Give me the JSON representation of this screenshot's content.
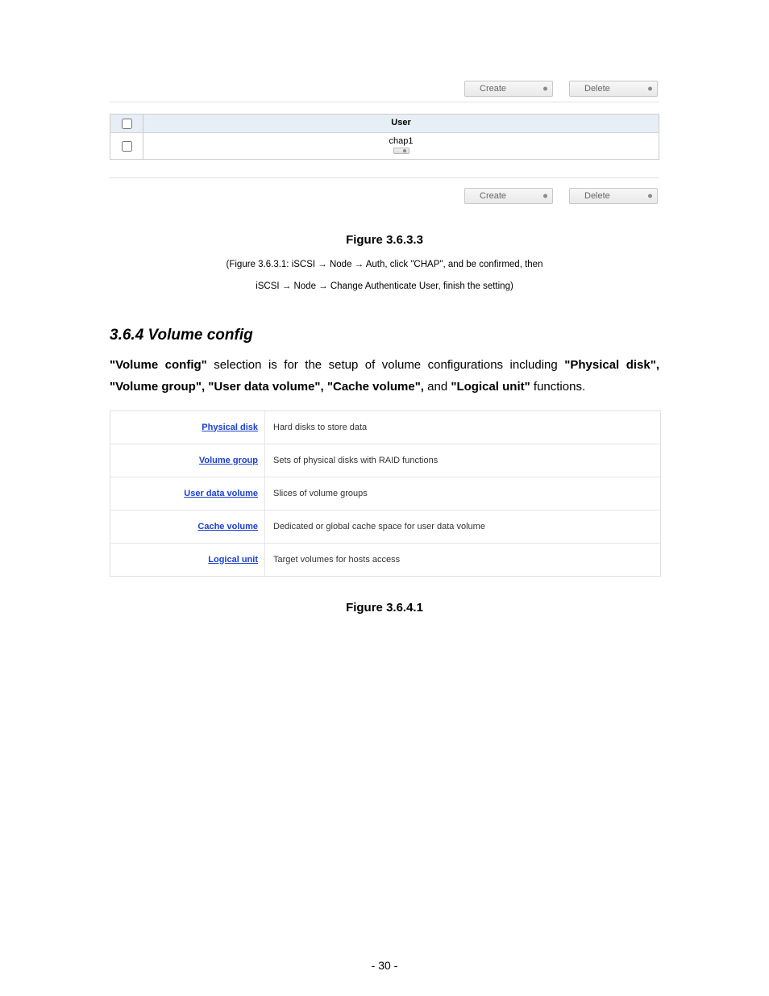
{
  "toolbar": {
    "create": "Create",
    "delete": "Delete"
  },
  "userTable": {
    "header": "User",
    "rows": [
      {
        "name": "chap1"
      }
    ]
  },
  "figure1": "Figure 3.6.3.3",
  "note_line1": "(Figure 3.6.3.1: iSCSI → Node → Auth, click \"CHAP\", and be confirmed, then",
  "note_line2": "iSCSI → Node → Change Authenticate User, finish the setting)",
  "section_heading": "3.6.4 Volume config",
  "body_text_prefix": "\"Volume config\"",
  "body_text_1": " selection is for the setup of volume configurations including ",
  "body_text_items": "\"Physical disk\", \"Volume group\", \"User data volume\", \"Cache volume\",",
  "body_text_and": " and ",
  "body_text_logical": "\"Logical unit\"",
  "body_text_tail": " functions.",
  "defs": [
    {
      "label": "Physical disk",
      "desc": "Hard disks to store data"
    },
    {
      "label": "Volume group",
      "desc": "Sets of physical disks with RAID functions"
    },
    {
      "label": "User data volume",
      "desc": "Slices of volume groups"
    },
    {
      "label": "Cache volume",
      "desc": "Dedicated or global cache space for user data volume"
    },
    {
      "label": "Logical unit",
      "desc": "Target volumes for hosts access"
    }
  ],
  "figure2": "Figure 3.6.4.1",
  "page_number": "- 30 -"
}
